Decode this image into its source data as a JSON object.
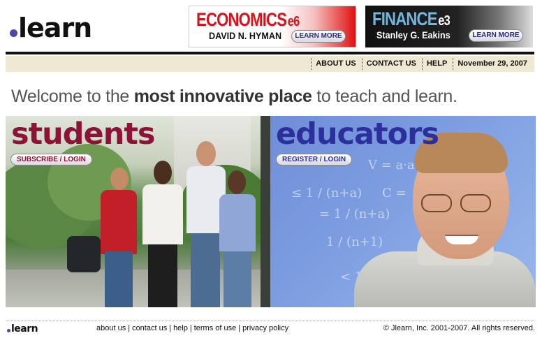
{
  "logo": {
    "text": "learn"
  },
  "ads": [
    {
      "title": "ECONOMICS",
      "edition": "e6",
      "author": "DAVID N. HYMAN",
      "button": "LEARN MORE"
    },
    {
      "title": "FINANCE",
      "edition": "e3",
      "author": "Stanley G. Eakins",
      "button": "LEARN MORE"
    }
  ],
  "nav": {
    "items": [
      "ABOUT US",
      "CONTACT US",
      "HELP"
    ],
    "date": "November 29, 2007"
  },
  "welcome": {
    "part1": "Welcome to the ",
    "highlight": "most innovative place",
    "part2": " to teach and learn."
  },
  "students": {
    "heading": "students",
    "button": "SUBSCRIBE / LOGIN"
  },
  "educators": {
    "heading": "educators",
    "button": "REGISTER / LOGIN"
  },
  "footer": {
    "logo": "learn",
    "links": [
      "about us",
      "contact us",
      "help",
      "terms of use",
      "privacy policy"
    ],
    "separator": "|",
    "copyright": "© Jlearn, Inc. 2001-2007.  All rights reserved."
  },
  "colors": {
    "students_accent": "#8c1238",
    "educators_accent": "#2d2f9c",
    "nav_bg": "#efe9d3",
    "logo_dot": "#4b46a8"
  }
}
